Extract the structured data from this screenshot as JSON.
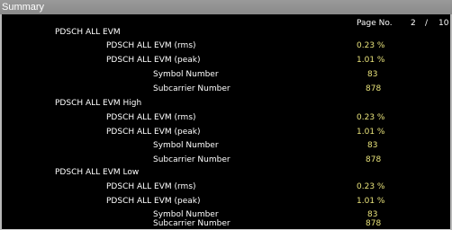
{
  "window": {
    "title": "Summary"
  },
  "page": {
    "label": "Page No.",
    "current": "2",
    "separator": "/",
    "total": "10"
  },
  "groups": [
    {
      "heading": "PDSCH ALL EVM",
      "rows": [
        {
          "label": "PDSCH ALL EVM (rms)",
          "value": "0.23 %"
        },
        {
          "label": "PDSCH ALL EVM (peak)",
          "value": "1.01 %"
        },
        {
          "label": "Symbol Number",
          "value": "83"
        },
        {
          "label": "Subcarrier Number",
          "value": "878"
        }
      ]
    },
    {
      "heading": "PDSCH ALL EVM High",
      "rows": [
        {
          "label": "PDSCH ALL EVM (rms)",
          "value": "0.23 %"
        },
        {
          "label": "PDSCH ALL EVM (peak)",
          "value": "1.01 %"
        },
        {
          "label": "Symbol Number",
          "value": "83"
        },
        {
          "label": "Subcarrier Number",
          "value": "878"
        }
      ]
    },
    {
      "heading": "PDSCH ALL EVM Low",
      "rows": [
        {
          "label": "PDSCH ALL EVM (rms)",
          "value": "0.23 %"
        },
        {
          "label": "PDSCH ALL EVM (peak)",
          "value": "1.01 %"
        },
        {
          "label": "Symbol Number",
          "value": "83"
        },
        {
          "label": "Subcarrier Number",
          "value": "878"
        }
      ]
    }
  ],
  "colors": {
    "background": "#000000",
    "label": "#ffffff",
    "value": "#e8e27a",
    "title_bar": "#8f8f8f"
  }
}
